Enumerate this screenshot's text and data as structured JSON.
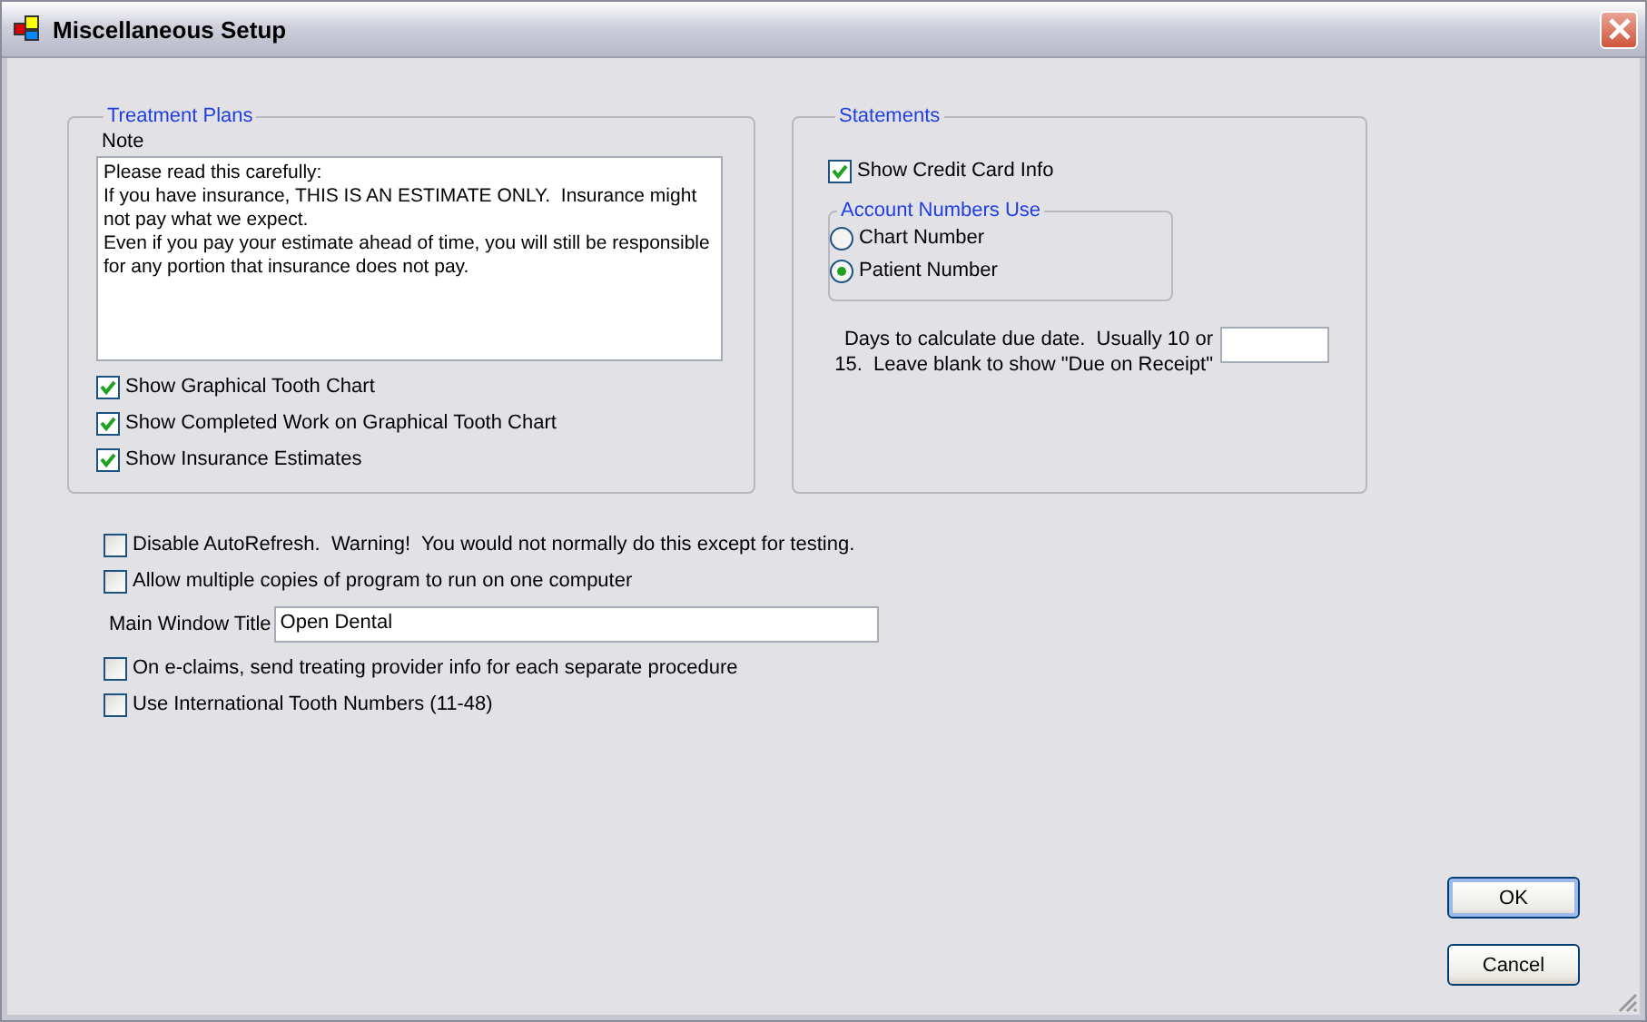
{
  "window": {
    "title": "Miscellaneous Setup"
  },
  "treatment_plans": {
    "title": "Treatment Plans",
    "note_label": "Note",
    "note": "Please read this carefully:\nIf you have insurance, THIS IS AN ESTIMATE ONLY.  Insurance might not pay what we expect.\nEven if you pay your estimate ahead of time, you will still be responsible for any portion that insurance does not pay.",
    "options": [
      {
        "label": "Show Graphical Tooth Chart",
        "checked": true
      },
      {
        "label": "Show Completed Work on Graphical Tooth Chart",
        "checked": true
      },
      {
        "label": "Show Insurance Estimates",
        "checked": true
      }
    ]
  },
  "statements": {
    "title": "Statements",
    "credit_card": {
      "label": "Show Credit Card Info",
      "checked": true
    },
    "account_numbers": {
      "title": "Account Numbers Use",
      "options": [
        {
          "label": "Chart Number",
          "selected": false
        },
        {
          "label": "Patient Number",
          "selected": true
        }
      ]
    },
    "due_date": {
      "label": "Days to calculate due date.  Usually 10 or 15.  Leave blank to show \"Due on Receipt\""
    }
  },
  "general_options": [
    {
      "kind": "checkbox",
      "label": "Disable AutoRefresh.  Warning!  You would not normally do this except for testing.",
      "checked": false
    },
    {
      "kind": "checkbox",
      "label": "Allow multiple copies of program to run on one computer",
      "checked": false
    },
    {
      "kind": "field",
      "label": "Main Window Title",
      "value": "Open Dental"
    },
    {
      "kind": "checkbox",
      "label": "On e-claims, send treating provider info for each separate procedure",
      "checked": false
    },
    {
      "kind": "checkbox",
      "label": "Use International Tooth Numbers (11-48)",
      "checked": false
    }
  ],
  "buttons": [
    {
      "label": "OK",
      "default": true
    },
    {
      "label": "Cancel",
      "default": false
    }
  ]
}
